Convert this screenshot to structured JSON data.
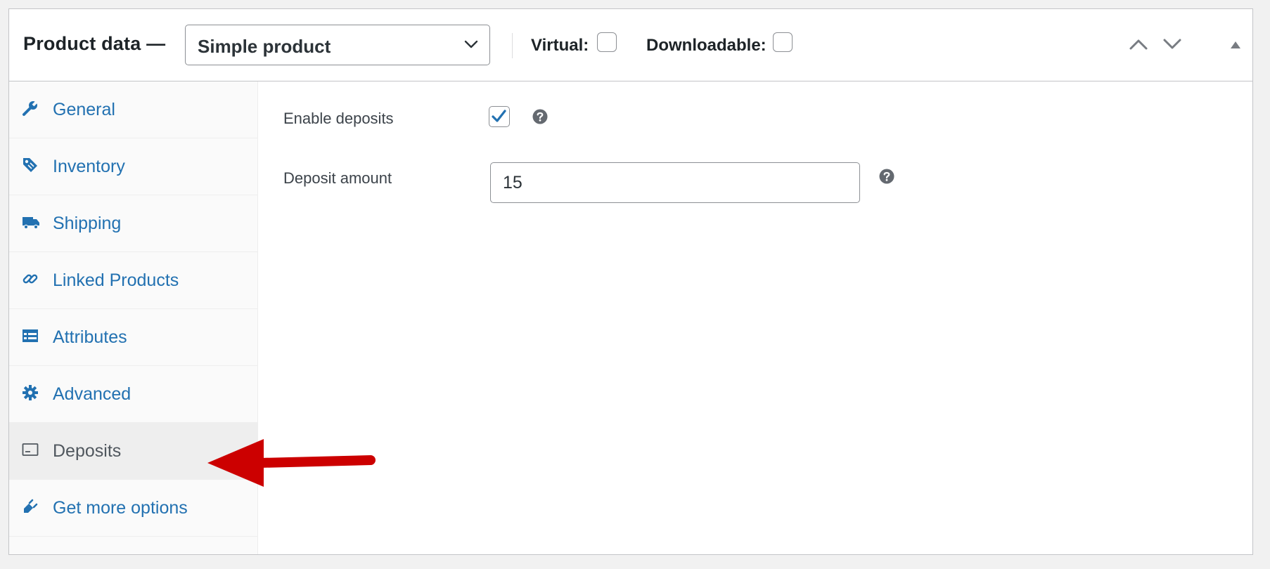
{
  "header": {
    "title": "Product data —",
    "product_type": "Simple product",
    "options": [
      {
        "label": "Virtual:",
        "checked": false
      },
      {
        "label": "Downloadable:",
        "checked": false
      }
    ]
  },
  "sidebar": {
    "tabs": [
      {
        "label": "General",
        "icon": "wrench-icon",
        "active": false
      },
      {
        "label": "Inventory",
        "icon": "tag-icon",
        "active": false
      },
      {
        "label": "Shipping",
        "icon": "truck-icon",
        "active": false
      },
      {
        "label": "Linked Products",
        "icon": "link-icon",
        "active": false
      },
      {
        "label": "Attributes",
        "icon": "list-icon",
        "active": false
      },
      {
        "label": "Advanced",
        "icon": "gear-icon",
        "active": false
      },
      {
        "label": "Deposits",
        "icon": "card-icon",
        "active": true
      },
      {
        "label": "Get more options",
        "icon": "plugin-icon",
        "active": false
      }
    ]
  },
  "fields": {
    "enable_deposits": {
      "label": "Enable deposits",
      "checked": true
    },
    "deposit_amount": {
      "label": "Deposit amount",
      "value": "15"
    }
  },
  "colors": {
    "link": "#2271b1",
    "active_tab_bg": "#eeeeee",
    "annotation_arrow": "#cc0000"
  }
}
